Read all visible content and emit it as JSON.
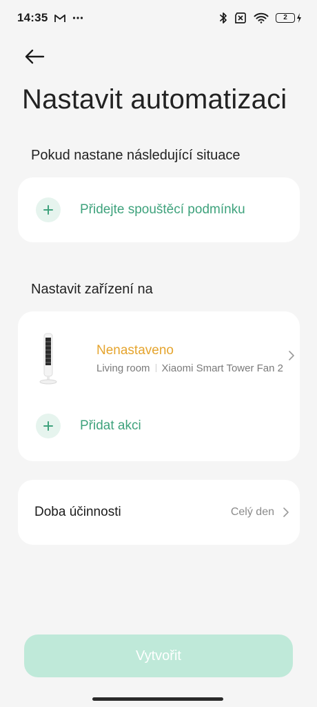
{
  "status_bar": {
    "time": "14:35",
    "notif_icons": [
      "gmail-icon",
      "more-dots-icon"
    ],
    "right_icons": [
      "bluetooth-icon",
      "sim-off-icon",
      "wifi-icon"
    ],
    "battery_level": "2"
  },
  "header": {
    "back_icon": "arrow-left-icon",
    "title": "Nastavit automatizaci"
  },
  "trigger_section": {
    "label": "Pokud nastane následující situace",
    "add_label": "Přidejte spouštěcí podmínku"
  },
  "device_section": {
    "label": "Nastavit zařízení na",
    "device": {
      "status": "Nenastaveno",
      "room": "Living room",
      "name": "Xiaomi Smart Tower Fan 2"
    },
    "add_action_label": "Přidat akci"
  },
  "period": {
    "label": "Doba účinnosti",
    "value": "Celý den"
  },
  "create_button": "Vytvořit",
  "colors": {
    "accent_green": "#3ea27c",
    "warning_orange": "#e5a42d",
    "button_disabled": "#bfe9d9"
  }
}
